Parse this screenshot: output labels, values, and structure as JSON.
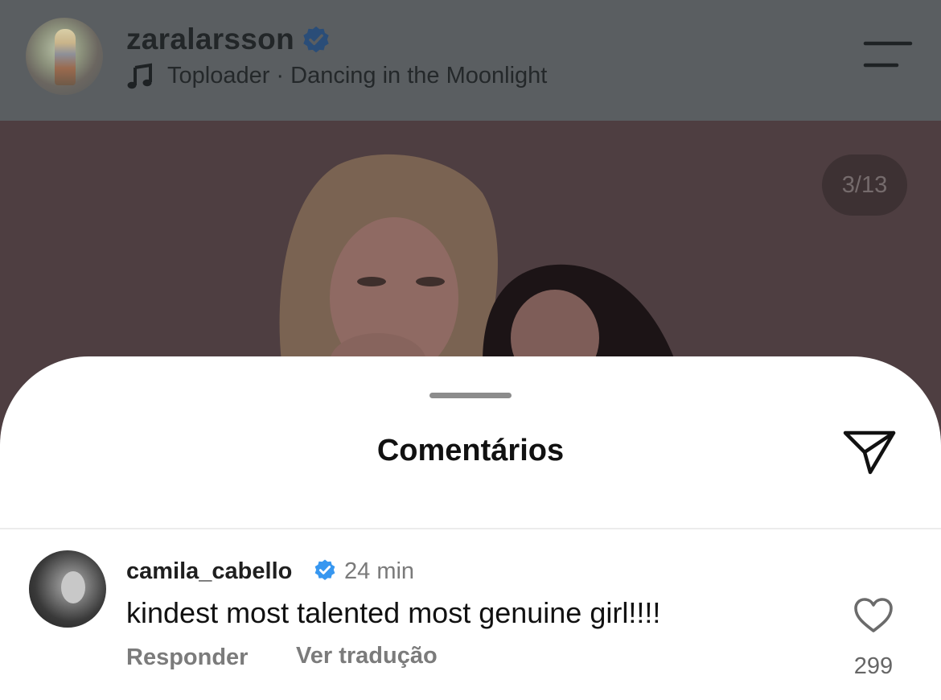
{
  "header": {
    "username": "zaralarsson",
    "verified_icon": "verified-badge-icon",
    "music_icon": "music-note-icon",
    "music": "Toploader · Dancing in the Moonlight",
    "menu_icon": "menu-icon"
  },
  "post": {
    "counter": "3/13"
  },
  "sheet": {
    "title": "Comentários",
    "share_icon": "send-icon"
  },
  "comment": {
    "username": "camila_cabello",
    "time": "24 min",
    "text": "kindest most talented most genuine girl!!!!",
    "reply_label": "Responder",
    "translate_label": "Ver tradução",
    "likes": "299",
    "like_icon": "heart-icon"
  },
  "colors": {
    "verified_blue": "#3797f0",
    "dim_header": "#5a5e61",
    "dim_photo": "#4e3e41"
  }
}
